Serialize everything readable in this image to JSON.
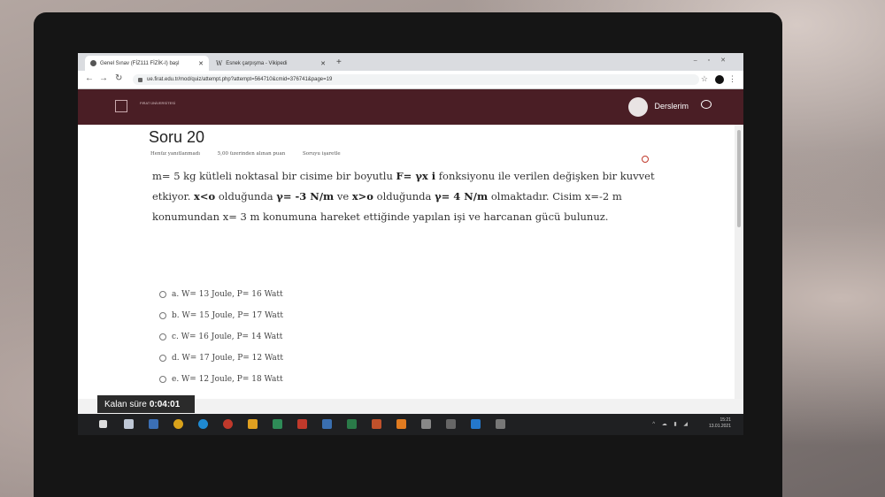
{
  "browser": {
    "tabs": [
      {
        "title": "Genel Sınav (FİZ111 FİZİK-I) başl",
        "active": true
      },
      {
        "title": "Esnek çarpışma - Vikipedi",
        "active": false
      }
    ],
    "url": "ue.firat.edu.tr/mod/quiz/attempt.php?attempt=564710&cmid=376741&page=19"
  },
  "site": {
    "logo_text": "FIRAT ÜNİVERSİTESİ",
    "user_menu": "Derslerim"
  },
  "question": {
    "title": "Soru 20",
    "status": "Henüz yanıtlanmadı",
    "points": "5,00 üzerinden alınan puan",
    "flag": "Soruyu işaretle",
    "text_parts": {
      "p1": "m= 5 kg kütleli noktasal bir cisime bir boyutlu ",
      "force": "F= γx i",
      "p2": " fonksiyonu ile verilen değişken bir kuvvet etkiyor. ",
      "cond1": "x<o",
      "p3": " olduğunda ",
      "g1": "γ= -3 N/m",
      "p4": " ve ",
      "cond2": "x>o",
      "p5": " olduğunda ",
      "g2": "γ= 4 N/m",
      "p6": " olmaktadır. Cisim x=-2 m konumundan  x= 3 m  konumuna hareket ettiğinde yapılan işi ve harcanan gücü bulunuz."
    },
    "answers": [
      "a. W= 13 Joule,  P= 16 Watt",
      "b. W= 15 Joule,  P= 17 Watt",
      "c. W= 16 Joule,  P= 14 Watt",
      "d. W= 17 Joule,  P= 12 Watt",
      "e. W= 12 Joule,  P= 18 Watt"
    ]
  },
  "timer": {
    "label": "Kalan süre",
    "value": "0:04:01"
  },
  "taskbar": {
    "time": "15:21",
    "date": "13.01.2021"
  }
}
